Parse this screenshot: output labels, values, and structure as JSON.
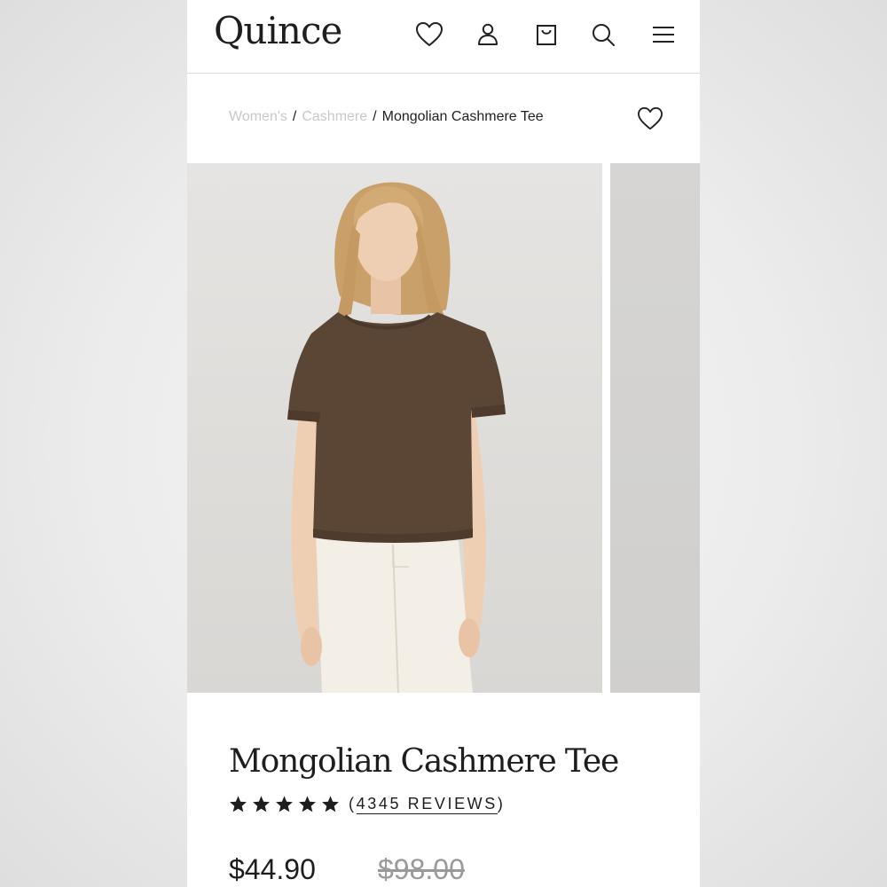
{
  "header": {
    "logo": "Quince",
    "icons": [
      "heart-icon",
      "account-icon",
      "bag-icon",
      "search-icon",
      "menu-icon"
    ]
  },
  "breadcrumb": {
    "items": [
      "Women's",
      "Cashmere"
    ],
    "separator": "/",
    "current": "Mongolian Cashmere Tee"
  },
  "product": {
    "title": "Mongolian Cashmere Tee",
    "rating": 5,
    "reviews_open": "(",
    "reviews_label": "4345 REVIEWS",
    "reviews_close": ")",
    "price": "$44.90",
    "compare_price": "$98.00"
  },
  "colors": {
    "text": "#1d1d1d",
    "muted_link": "#c8c8c8",
    "strike_price": "#9a9a9a",
    "sweater": "#5b4636",
    "jeans": "#f3efe6"
  }
}
